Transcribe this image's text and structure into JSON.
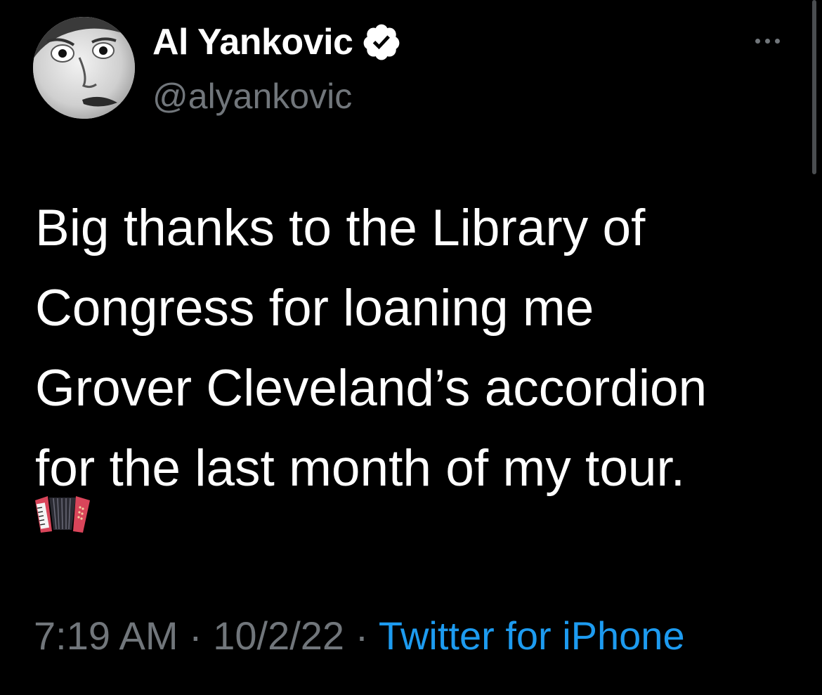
{
  "author": {
    "display_name": "Al Yankovic",
    "handle": "@alyankovic",
    "verified_icon": "verified-badge-icon",
    "avatar_icon": "profile-photo"
  },
  "header": {
    "more_icon": "more-options-icon"
  },
  "tweet": {
    "text": "Big thanks to the Library of\nCongress for loaning me\nGrover Cleveland’s accordion\nfor the last month of my tour.",
    "emoji": "accordion-emoji-icon"
  },
  "meta": {
    "time": "7:19 AM",
    "separator": " · ",
    "date": "10/2/22",
    "source": "Twitter for iPhone"
  },
  "colors": {
    "background": "#000000",
    "text": "#ffffff",
    "muted": "#71767b",
    "link": "#1d9bf0"
  }
}
